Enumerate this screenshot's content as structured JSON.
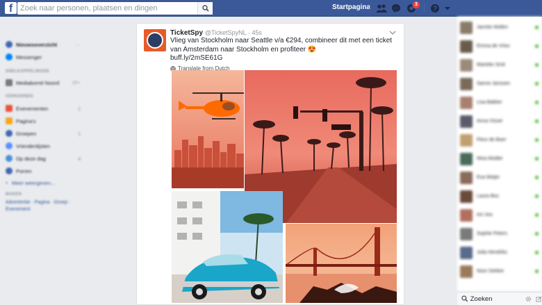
{
  "topbar": {
    "logo": "f",
    "search_placeholder": "Zoek naar personen, plaatsen en dingen",
    "home_label": "Startpagina",
    "notifications_count": "3",
    "icons": [
      "friends-icon",
      "messenger-icon",
      "notifications-icon",
      "help-icon",
      "chevron-down-icon"
    ]
  },
  "left": {
    "items_top": [
      {
        "label": "Nieuwsoverzicht",
        "color": "#4267b2",
        "count": "···"
      },
      {
        "label": "Messenger",
        "color": "#0084ff",
        "count": ""
      }
    ],
    "shortcuts_header": "SNELKOPPELINGEN",
    "shortcuts": [
      {
        "label": "Mediaborrel Noord",
        "color": "#7a7a7a",
        "count": "20+"
      }
    ],
    "explore_header": "VERKENNEN",
    "explore": [
      {
        "label": "Evenementen",
        "color": "#e9533b",
        "count": "1"
      },
      {
        "label": "Pagina's",
        "color": "#f5a623",
        "count": ""
      },
      {
        "label": "Groepen",
        "color": "#4267b2",
        "count": "1"
      },
      {
        "label": "Vriendenlijsten",
        "color": "#5890ff",
        "count": ""
      },
      {
        "label": "Op deze dag",
        "color": "#4a90d9",
        "count": "4"
      },
      {
        "label": "Porren",
        "color": "#4267b2",
        "count": ""
      }
    ],
    "more_label": "Meer weergeven...",
    "create_header": "MAKEN",
    "create_links": "Advertentie · Pagina · Groep · Evenement"
  },
  "post": {
    "author": "TicketSpy",
    "handle": "@TicketSpyNL · 45s",
    "text": "Vlieg van Stockholm naar Seattle v/a €294, combineer dit met een ticket van Amsterdam naar Stockholm en profiteer 😍",
    "link": "buff.ly/2mSE61G",
    "translate": "Translate from Dutch",
    "photos": [
      "helicopter-city-photo",
      "palm-street-photo",
      "vintage-car-photo",
      "golden-gate-bridge-photo"
    ]
  },
  "chat": {
    "contacts": [
      {
        "name": "Jannke Mollen",
        "color": "#8a7a6a"
      },
      {
        "name": "Emma de Vries",
        "color": "#6a5a4a"
      },
      {
        "name": "Marieke Smit",
        "color": "#9a8a7a"
      },
      {
        "name": "Sanne Janssen",
        "color": "#7a6a5a"
      },
      {
        "name": "Lisa Bakker",
        "color": "#a88070"
      },
      {
        "name": "Anna Visser",
        "color": "#5a5a6a"
      },
      {
        "name": "Fleur de Boer",
        "color": "#c0a070"
      },
      {
        "name": "Nina Mulder",
        "color": "#4a6a5a"
      },
      {
        "name": "Eva Meijer",
        "color": "#8a6a5a"
      },
      {
        "name": "Laura Bos",
        "color": "#6a4a3a"
      },
      {
        "name": "Iris Vos",
        "color": "#b07060"
      },
      {
        "name": "Sophie Peters",
        "color": "#7a7a7a"
      },
      {
        "name": "Julia Hendriks",
        "color": "#5a6a8a"
      },
      {
        "name": "Noor Dekker",
        "color": "#9a7a5a"
      }
    ],
    "search_label": "Zoeken",
    "icons": [
      "search-icon",
      "settings-icon",
      "new-message-icon"
    ]
  }
}
